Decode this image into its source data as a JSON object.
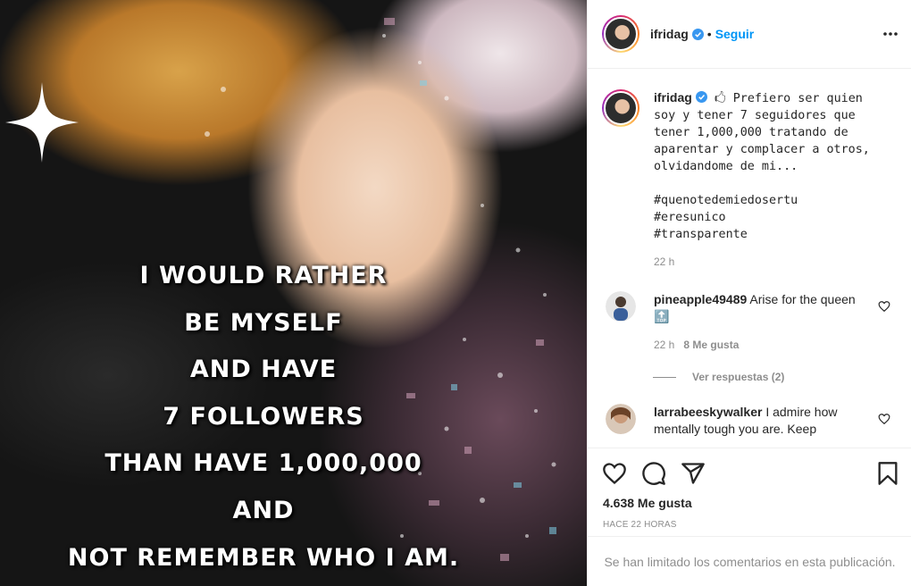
{
  "post": {
    "quote_lines": [
      "I WOULD RATHER",
      "BE MYSELF",
      "AND HAVE",
      "7 FOLLOWERS",
      "THAN HAVE 1,000,000",
      "AND",
      "NOT REMEMBER WHO I AM."
    ]
  },
  "header": {
    "username": "ifridag",
    "separator": "•",
    "follow_label": "Seguir"
  },
  "caption": {
    "username": "ifridag",
    "emoji": "🖒",
    "text": " Prefiero ser quien soy y tener 7 seguidores que tener 1,000,000 tratando de aparentar y complacer a otros, olvidandome de mi...\n\n#quenotedemiedosertu\n#eresunico\n#transparente",
    "time": "22 h"
  },
  "comments": [
    {
      "username": "pineapple49489",
      "text": "Arise for the queen",
      "emoji": "🔝",
      "time": "22 h",
      "likes": "8 Me gusta",
      "replies": "Ver respuestas (2)"
    },
    {
      "username": "larrabeeskywalker",
      "text": "I admire how mentally tough you are. Keep"
    }
  ],
  "actions": {
    "likes": "4.638 Me gusta",
    "timestamp": "HACE 22 HORAS",
    "comments_limited": "Se han limitado los comentarios en esta publicación."
  },
  "colors": {
    "link_blue": "#0095f6",
    "verified_blue": "#3897f0",
    "muted": "#8e8e8e",
    "divider": "#efefef"
  },
  "icons": [
    "verified-badge-icon",
    "more-options-icon",
    "heart-icon",
    "comment-icon",
    "share-icon",
    "bookmark-icon",
    "sparkle-star-icon"
  ]
}
